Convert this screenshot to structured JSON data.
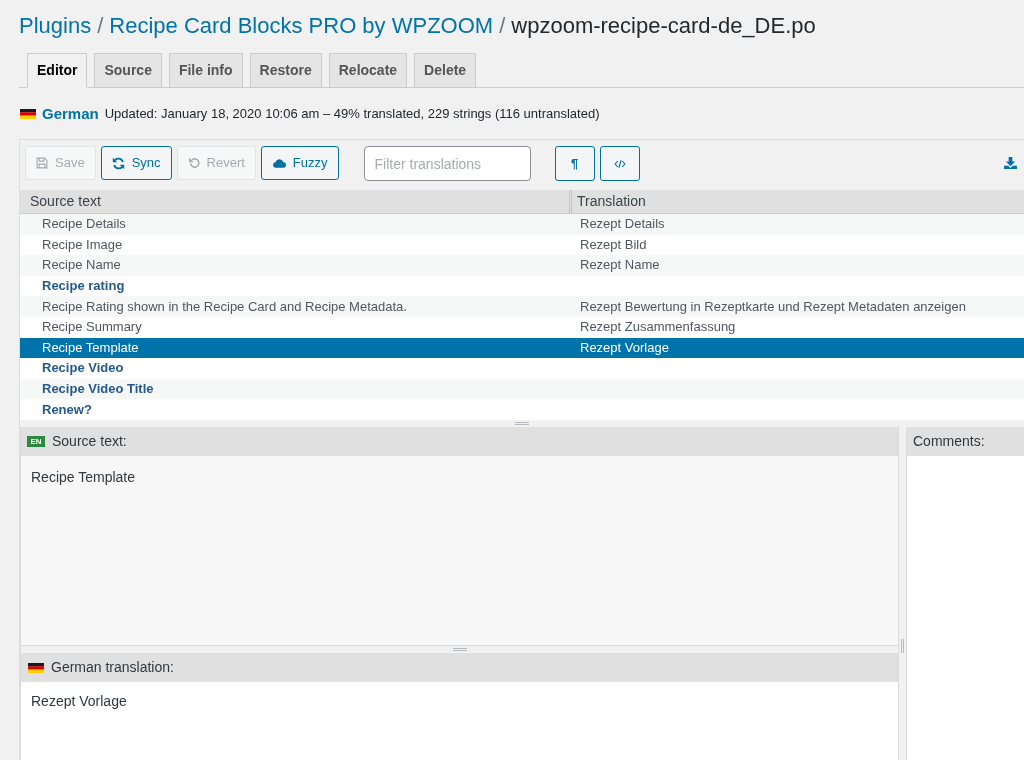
{
  "breadcrumb": [
    {
      "kind": "link",
      "text": "Plugins"
    },
    {
      "kind": "separator",
      "text": "/"
    },
    {
      "kind": "link",
      "text": "Recipe Card Blocks PRO by WPZOOM"
    },
    {
      "kind": "separator",
      "text": "/"
    },
    {
      "kind": "current",
      "text": "wpzoom-recipe-card-de_DE.po"
    }
  ],
  "tabs": [
    {
      "label": "Editor",
      "selected": true
    },
    {
      "label": "Source",
      "selected": false
    },
    {
      "label": "File info",
      "selected": false
    },
    {
      "label": "Restore",
      "selected": false
    },
    {
      "label": "Relocate",
      "selected": false
    },
    {
      "label": "Delete",
      "selected": false
    }
  ],
  "status": {
    "language": "German",
    "details": "Updated: January 18, 2020 10:06 am – 49% translated, 229 strings (116 untranslated)"
  },
  "toolbar": {
    "buttons": [
      {
        "kind": "save",
        "label": "Save",
        "disabled": true
      },
      {
        "kind": "sync",
        "label": "Sync",
        "disabled": false
      },
      {
        "kind": "revert",
        "label": "Revert",
        "disabled": true
      },
      {
        "kind": "fuzzy",
        "label": "Fuzzy",
        "disabled": false
      }
    ],
    "filter": {
      "placeholder": "Filter translations"
    },
    "toggles": [
      {
        "kind": "invisibles",
        "label": "¶"
      },
      {
        "kind": "code"
      }
    ]
  },
  "table": {
    "columns": [
      "Source text",
      "Translation"
    ],
    "rows": [
      {
        "source": "Recipe Details",
        "translation": "Rezept Details",
        "untranslated": false,
        "selected": false
      },
      {
        "source": "Recipe Image",
        "translation": "Rezept Bild",
        "untranslated": false,
        "selected": false
      },
      {
        "source": "Recipe Name",
        "translation": "Rezept Name",
        "untranslated": false,
        "selected": false
      },
      {
        "source": "Recipe rating",
        "untranslated": true,
        "selected": false
      },
      {
        "source": "Recipe Rating shown in the Recipe Card and Recipe Metadata.",
        "translation": "Rezept Bewertung in Rezeptkarte und Rezept Metadaten anzeigen",
        "untranslated": false,
        "selected": false
      },
      {
        "source": "Recipe Summary",
        "translation": "Rezept Zusammenfassung",
        "untranslated": false,
        "selected": false
      },
      {
        "source": "Recipe Template",
        "translation": "Rezept Vorlage",
        "untranslated": false,
        "selected": true
      },
      {
        "source": "Recipe Video",
        "untranslated": true,
        "selected": false
      },
      {
        "source": "Recipe Video Title",
        "untranslated": true,
        "selected": false
      },
      {
        "source": "Renew?",
        "untranslated": true,
        "selected": false
      }
    ]
  },
  "source_panel": {
    "badge": "EN",
    "title": "Source text:",
    "text": "Recipe Template"
  },
  "translation_panel": {
    "title": "German translation:",
    "value": "Rezept Vorlage"
  },
  "comments_panel": {
    "title": "Comments:"
  }
}
